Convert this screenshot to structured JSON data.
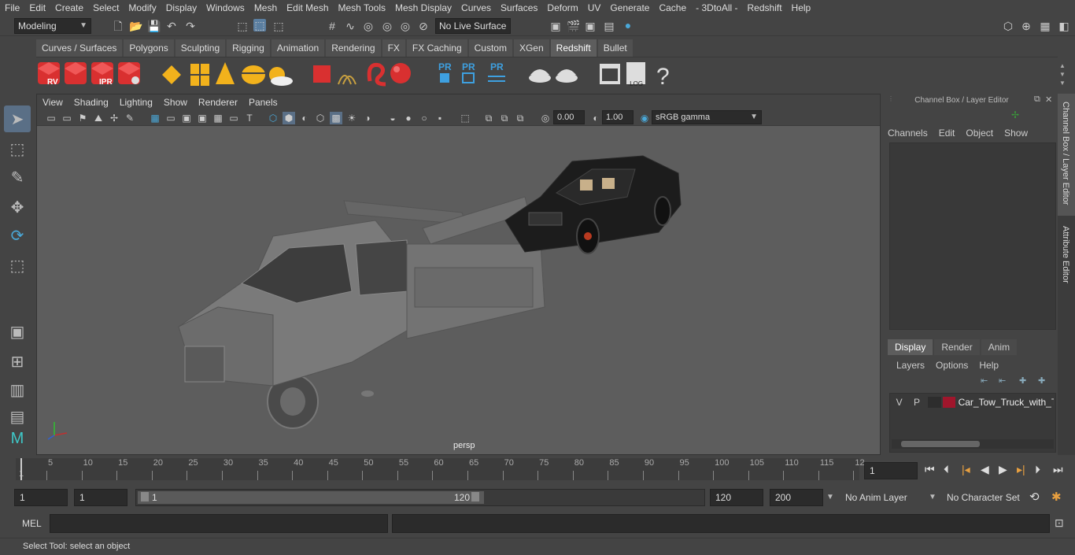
{
  "menus": [
    "File",
    "Edit",
    "Create",
    "Select",
    "Modify",
    "Display",
    "Windows",
    "Mesh",
    "Edit Mesh",
    "Mesh Tools",
    "Mesh Display",
    "Curves",
    "Surfaces",
    "Deform",
    "UV",
    "Generate",
    "Cache",
    "- 3DtoAll -",
    "Redshift",
    "Help"
  ],
  "status": {
    "mode": "Modeling",
    "live_surface": "No Live Surface"
  },
  "shelf_tabs": [
    "Curves / Surfaces",
    "Polygons",
    "Sculpting",
    "Rigging",
    "Animation",
    "Rendering",
    "FX",
    "FX Caching",
    "Custom",
    "XGen",
    "Redshift",
    "Bullet"
  ],
  "active_shelf": "Redshift",
  "shelf_labels": {
    "rv": "RV",
    "ipr": "IPR",
    "pr1": "PR",
    "pr2": "PR",
    "pr3": "PR",
    "log": ".LOG",
    "help": "?"
  },
  "viewport": {
    "menus": [
      "View",
      "Shading",
      "Lighting",
      "Show",
      "Renderer",
      "Panels"
    ],
    "exposure": "0.00",
    "gamma": "1.00",
    "colorspace": "sRGB gamma",
    "camera_label": "persp"
  },
  "channel_box": {
    "title": "Channel Box / Layer Editor",
    "menus": [
      "Channels",
      "Edit",
      "Object",
      "Show"
    ]
  },
  "layer_editor": {
    "tabs": [
      "Display",
      "Render",
      "Anim"
    ],
    "active_tab": "Display",
    "menus": [
      "Layers",
      "Options",
      "Help"
    ],
    "layer": {
      "v": "V",
      "p": "P",
      "name": "Car_Tow_Truck_with_T",
      "color": "#a0162c"
    }
  },
  "side_tabs": [
    "Channel Box / Layer Editor",
    "Attribute Editor"
  ],
  "timeline": {
    "ticks": [
      "5",
      "10",
      "15",
      "20",
      "25",
      "30",
      "35",
      "40",
      "45",
      "50",
      "55",
      "60",
      "65",
      "70",
      "75",
      "80",
      "85",
      "90",
      "95",
      "100",
      "105",
      "110",
      "115",
      "12"
    ],
    "start_label": "1",
    "current_frame": "1"
  },
  "range": {
    "start": "1",
    "playback_start": "1",
    "slider_start": "1",
    "slider_end": "120",
    "playback_end": "120",
    "end": "200",
    "anim_layer": "No Anim Layer",
    "character_set": "No Character Set"
  },
  "mel": {
    "label": "MEL"
  },
  "help_line": "Select Tool: select an object"
}
